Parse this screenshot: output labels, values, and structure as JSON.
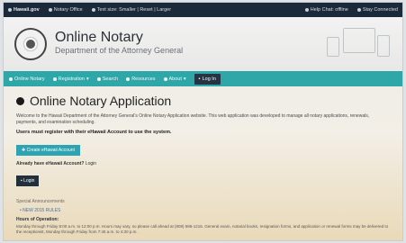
{
  "topbar": {
    "brand": "Hawaii.gov",
    "links": [
      "Notary Office",
      "Text size: Smaller | Reset | Larger"
    ],
    "right": [
      "Help Chat: offline",
      "Stay Connected"
    ]
  },
  "header": {
    "title": "Online Notary",
    "subtitle": "Department of the Attorney General"
  },
  "nav": {
    "items": [
      "Online Notary",
      "Registration",
      "Search",
      "Resources",
      "About"
    ],
    "login": "Log In"
  },
  "main": {
    "heading": "Online Notary Application",
    "intro": "Welcome to the Hawaii Department of the Attorney General's Online Notary Application website. This web application was developed to manage all notary applications, renewals, payments, and examination scheduling.",
    "must_register": "Users must register with their eHawaii Account to use the system.",
    "create_btn": "Create eHawaii Account",
    "have_account": "Already have eHawaii Account?",
    "login_link": "Login",
    "login_btn": "Login",
    "special_announcements": "Special Announcements",
    "announcement_link": "NEW 2015 RULES",
    "hours_heading": "Hours of Operation:",
    "hours_text": "Monday through Friday 8:00 a.m. to 12:00 p.m. Hours may vary, so please call ahead at (808) 586-1216. General exam, notarial books, resignation forms, and application or renewal forms may be delivered to the receptionist, Monday through Friday from 7:45 a.m. to 4:30 p.m."
  }
}
